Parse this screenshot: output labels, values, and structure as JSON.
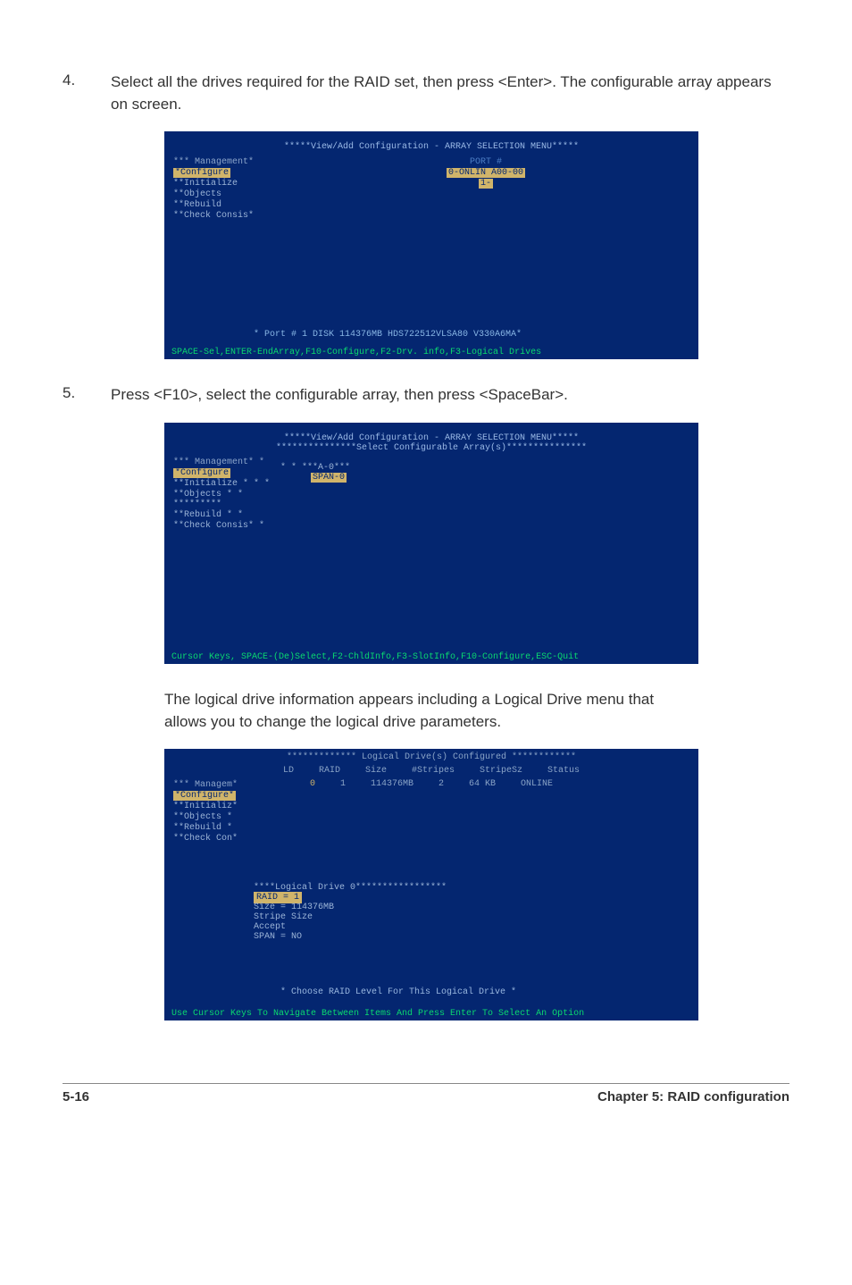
{
  "step4": {
    "num": "4.",
    "text": "Select all the drives required for the RAID set, then press <Enter>. The configurable array appears on screen."
  },
  "screen1": {
    "title": "*****View/Add Configuration - ARRAY SELECTION MENU*****",
    "managementTitle": "*** Management*",
    "configure": "*Configure",
    "initialize": "**Initialize",
    "objects": "**Objects",
    "rebuild": "**Rebuild",
    "checkConsis": "**Check Consis*",
    "portTitle": "PORT #",
    "portRow1": "0-ONLIN A00-00",
    "portRow2": "1-",
    "diskLine": "* Port # 1  DISK    114376MB  HDS722512VLSA80    V330A6MA*",
    "hint": "SPACE-Sel,ENTER-EndArray,F10-Configure,F2-Drv. info,F3-Logical Drives"
  },
  "step5": {
    "num": "5.",
    "text": "Press <F10>, select the configurable array, then press <SpaceBar>."
  },
  "screen2": {
    "title1": "*****View/Add Configuration - ARRAY SELECTION MENU*****",
    "title2": "***************Select Configurable Array(s)***************",
    "managementTitle": "*** Management* *",
    "configure": "*Configure",
    "a0": "* * ***A-0***",
    "initialize": "**Initialize  * * *",
    "span0": "SPAN-0",
    "objects": "**Objects     * * *********",
    "rebuild": "**Rebuild     * *",
    "checkConsis": "**Check Consis* *",
    "hint": "Cursor Keys, SPACE-(De)Select,F2-ChldInfo,F3-SlotInfo,F10-Configure,ESC-Quit"
  },
  "followText": "The logical drive information appears including a Logical Drive menu that allows you to change the logical drive parameters.",
  "screen3": {
    "header": "************* Logical Drive(s) Configured ************",
    "cols": {
      "ld": "LD",
      "raid": "RAID",
      "size": "Size",
      "stripes": "#Stripes",
      "stripesz": "StripeSz",
      "status": "Status"
    },
    "data": {
      "ld": "0",
      "raid": "1",
      "size": "114376MB",
      "stripes": "2",
      "stripesz": "64 KB",
      "status": "ONLINE"
    },
    "managementTitle": "*** Managem*",
    "configure": "*Configure*",
    "initialize": "**Initializ*",
    "objects": "**Objects  *",
    "rebuild": "**Rebuild  *",
    "checkCon": "**Check Con*",
    "logicalTitle": "****Logical Drive 0*****************",
    "raidLine": " RAID = 1",
    "sizeLine": " Size = 114376MB",
    "stripeLine": " Stripe Size",
    "acceptLine": " Accept",
    "spanLine": " SPAN = NO",
    "choose": "* Choose RAID Level For This Logical Drive *",
    "hint": "Use Cursor Keys To Navigate Between Items And Press Enter To Select An Option"
  },
  "footer": {
    "left": "5-16",
    "right": "Chapter 5: RAID configuration"
  }
}
